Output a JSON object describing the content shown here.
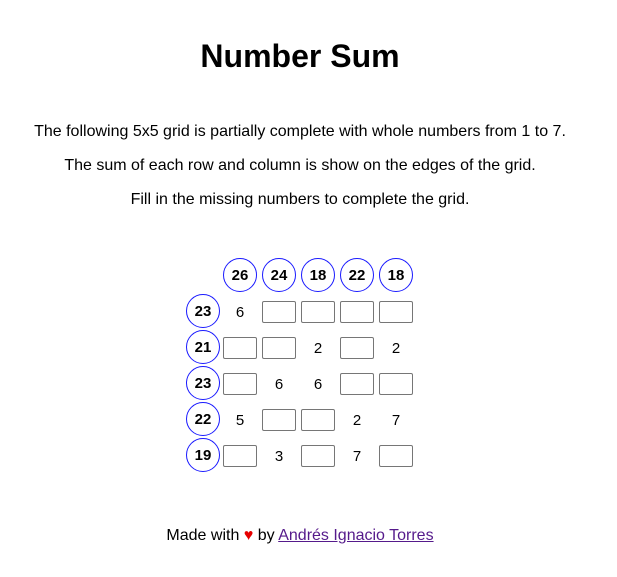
{
  "title": "Number Sum",
  "description": [
    "The following 5x5 grid is partially complete with whole numbers from 1 to 7.",
    "The sum of each row and column is show on the edges of the grid.",
    "Fill in the missing numbers to complete the grid."
  ],
  "grid": {
    "column_sums": [
      "26",
      "24",
      "18",
      "22",
      "18"
    ],
    "row_sums": [
      "23",
      "21",
      "23",
      "22",
      "19"
    ],
    "rows": [
      [
        "6",
        null,
        null,
        null,
        null
      ],
      [
        null,
        null,
        "2",
        null,
        "2"
      ],
      [
        null,
        "6",
        "6",
        null,
        null
      ],
      [
        "5",
        null,
        null,
        "2",
        "7"
      ],
      [
        null,
        "3",
        null,
        "7",
        null
      ]
    ]
  },
  "footer": {
    "made_with": "Made with",
    "heart": "♥",
    "by": "by",
    "author": "Andrés Ignacio Torres"
  },
  "colors": {
    "circle_border": "#1a1aff",
    "heart": "#e60000",
    "link": "#551a8b"
  }
}
